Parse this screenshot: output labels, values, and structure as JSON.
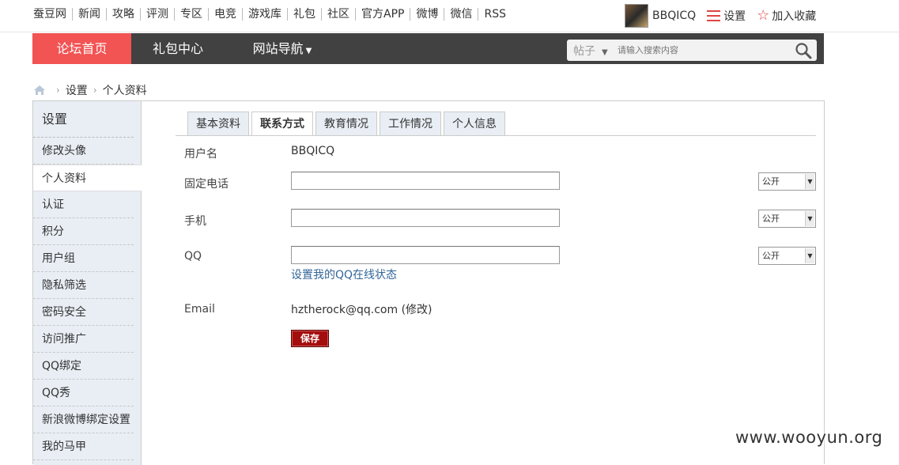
{
  "topnav": {
    "links": [
      "蚕豆网",
      "新闻",
      "攻略",
      "评测",
      "专区",
      "电竞",
      "游戏库",
      "礼包",
      "社区",
      "官方APP",
      "微博",
      "微信",
      "RSS"
    ],
    "username": "BBQICQ",
    "settings": "设置",
    "favorite": "加入收藏"
  },
  "mainnav": {
    "home": "论坛首页",
    "gift": "礼包中心",
    "site": "网站导航",
    "search_type": "帖子",
    "search_placeholder": "请输入搜索内容"
  },
  "breadcrumb": {
    "items": [
      "设置",
      "个人资料"
    ]
  },
  "sidebar": {
    "title": "设置",
    "items": [
      "修改头像",
      "个人资料",
      "认证",
      "积分",
      "用户组",
      "隐私筛选",
      "密码安全",
      "访问推广",
      "QQ绑定",
      "QQ秀",
      "新浪微博绑定设置",
      "我的马甲"
    ],
    "active_index": 1
  },
  "tabs": [
    "基本资料",
    "联系方式",
    "教育情况",
    "工作情况",
    "个人信息"
  ],
  "active_tab": 1,
  "form": {
    "username_label": "用户名",
    "username_value": "BBQICQ",
    "phone_label": "固定电话",
    "phone_value": "",
    "phone_privacy": "公开",
    "mobile_label": "手机",
    "mobile_value": "",
    "mobile_privacy": "公开",
    "qq_label": "QQ",
    "qq_value": "",
    "qq_privacy": "公开",
    "qq_status_link": "设置我的QQ在线状态",
    "email_label": "Email",
    "email_value": "hztherock@qq.com (修改)",
    "save_label": "保存"
  },
  "watermark": "www.wooyun.org",
  "colors": {
    "accent": "#f25353",
    "nav_bg": "#414141",
    "sidebar_bg": "#e8eef4",
    "save_bg": "#a30e0e",
    "link": "#336699"
  }
}
